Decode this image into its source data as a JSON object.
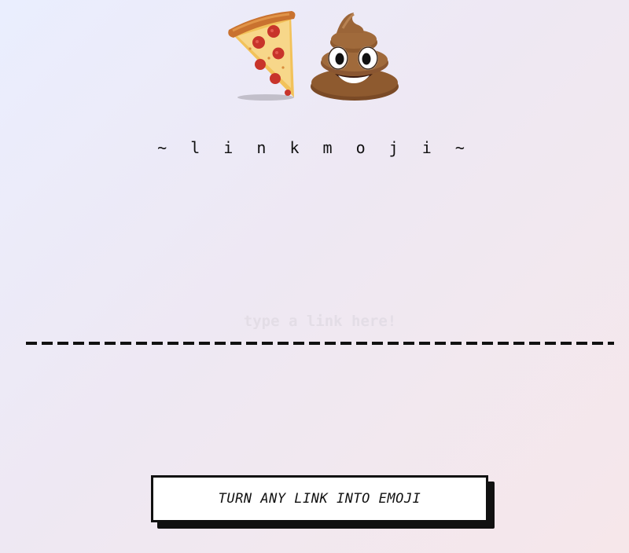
{
  "logo": {
    "emoji_left": "pizza-slice",
    "emoji_right": "pile-of-poo"
  },
  "brand": {
    "title": "~ l i n k m o j i ~"
  },
  "link_input": {
    "placeholder": "type a link here!",
    "value": ""
  },
  "convert_button": {
    "label": "TURN ANY LINK INTO EMOJI"
  },
  "colors": {
    "background_start": "#eaeefe",
    "background_end": "#f6e7ea",
    "ink": "#111111",
    "button_face": "#ffffff"
  }
}
